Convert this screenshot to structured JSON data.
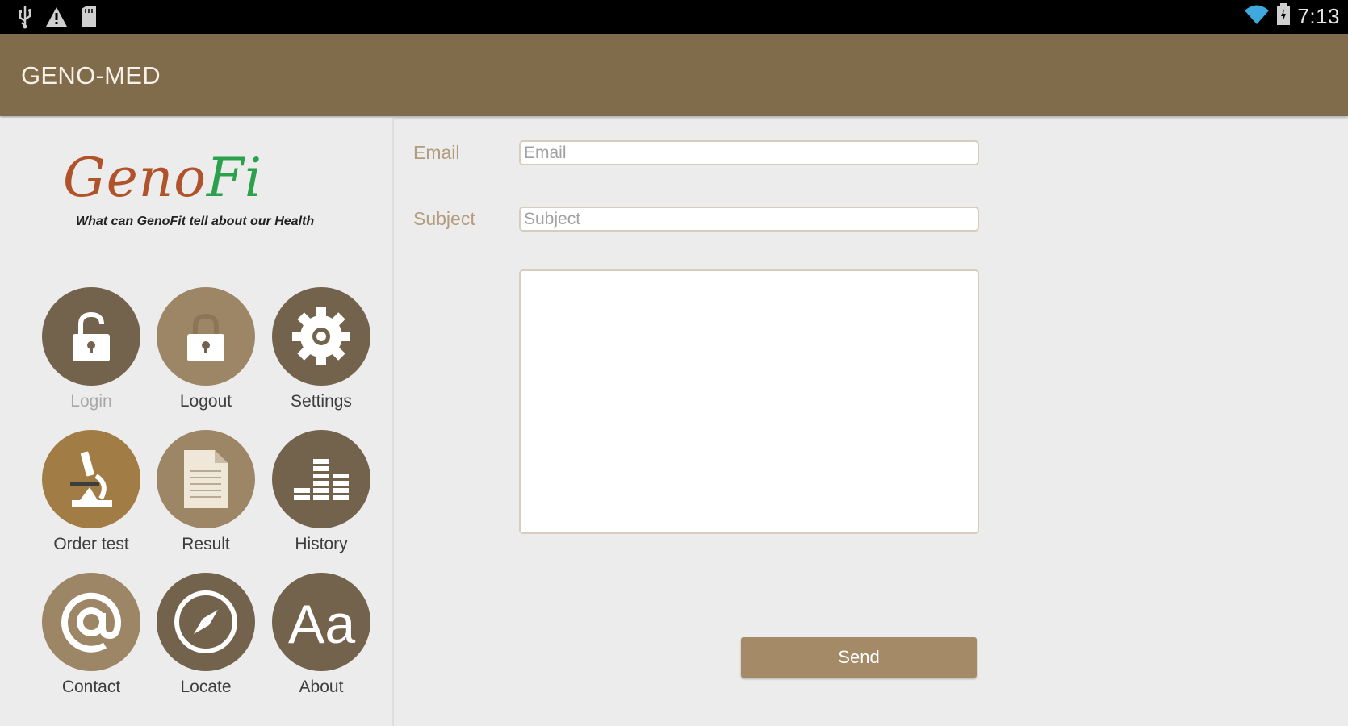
{
  "status_bar": {
    "time": "7:13",
    "left_icons": [
      "usb-icon",
      "warning-icon",
      "sd-card-icon"
    ],
    "right_icons": [
      "wifi-icon",
      "battery-icon"
    ]
  },
  "app": {
    "title": "GENO-MED"
  },
  "logo": {
    "text_geno": "Geno",
    "text_fi": "Fi",
    "tagline": "What can GenoFit tell about our Health"
  },
  "menu": {
    "items": [
      {
        "label": "Login",
        "icon": "unlock-icon"
      },
      {
        "label": "Logout",
        "icon": "lock-icon"
      },
      {
        "label": "Settings",
        "icon": "gear-icon"
      },
      {
        "label": "Order test",
        "icon": "microscope-icon"
      },
      {
        "label": "Result",
        "icon": "document-icon"
      },
      {
        "label": "History",
        "icon": "bar-chart-icon"
      },
      {
        "label": "Contact",
        "icon": "at-icon"
      },
      {
        "label": "Locate",
        "icon": "compass-icon"
      },
      {
        "label": "About",
        "icon": "text-aa-icon"
      }
    ]
  },
  "form": {
    "email_label": "Email",
    "email_placeholder": "Email",
    "email_value": "",
    "subject_label": "Subject",
    "subject_placeholder": "Subject",
    "subject_value": "",
    "message_value": "",
    "send_label": "Send"
  },
  "colors": {
    "action_bar": "#806b4b",
    "accent_tan": "#a48a66",
    "logo_geno": "#b0522a",
    "logo_fi": "#2aa14a"
  }
}
